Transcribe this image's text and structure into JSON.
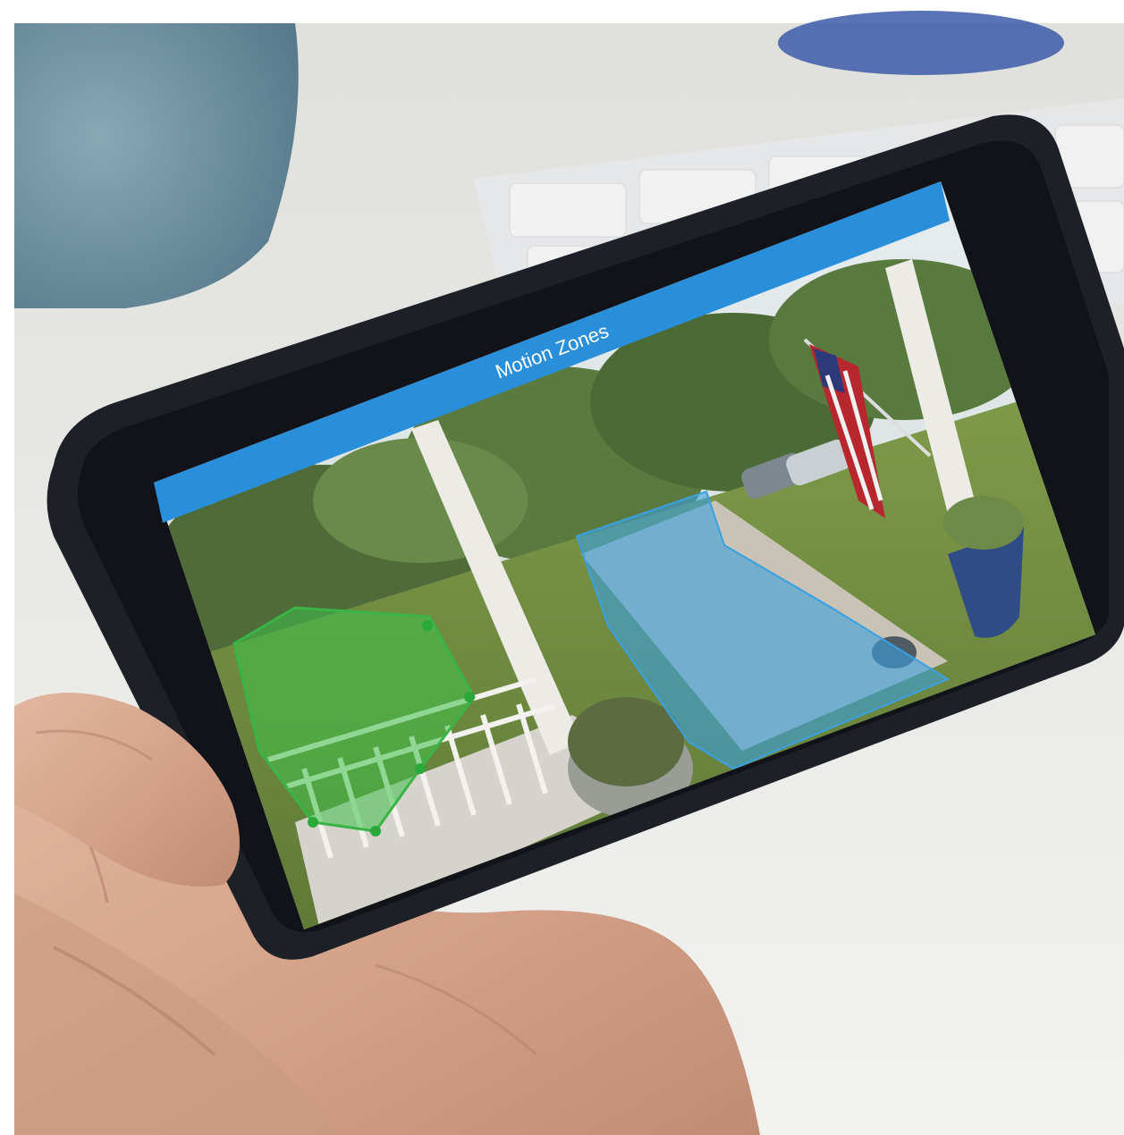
{
  "app": {
    "screen_title": "Motion Zones"
  },
  "zones": [
    {
      "name": "green-zone",
      "color": "#3fc14a"
    },
    {
      "name": "blue-zone",
      "color": "#3aa0e0"
    }
  ],
  "colors": {
    "title_bar": "#2a8fda",
    "phone_body": "#1d2026",
    "skin": "#d9a98f"
  }
}
